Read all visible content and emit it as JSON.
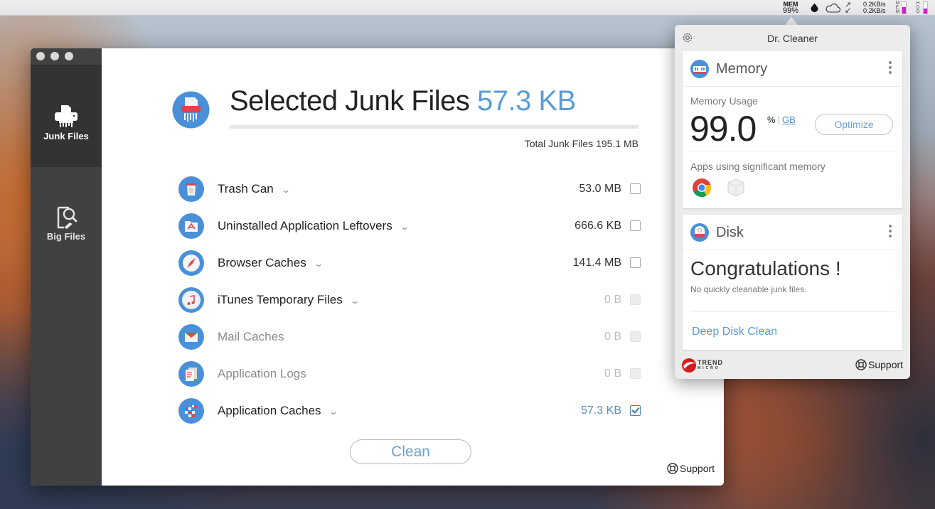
{
  "menubar": {
    "mem_label": "MEM",
    "mem_percent": "99%",
    "net_up": "0.2KB/s",
    "net_down": "0.2KB/s",
    "mem_gauge_label": "MEM",
    "hdd_gauge_label": "HDD",
    "mem_gauge_fill": 0.55,
    "hdd_gauge_fill": 0.45,
    "icons": [
      "drop-icon",
      "cloud-icon",
      "transfer-arrows-icon"
    ]
  },
  "sidebar": {
    "items": [
      {
        "label": "Junk Files",
        "icon": "shredder-icon",
        "active": true
      },
      {
        "label": "Big Files",
        "icon": "file-search-icon",
        "active": false
      }
    ]
  },
  "main": {
    "title_prefix": "Selected Junk Files",
    "selected_size": "57.3 KB",
    "total_label": "Total Junk Files 195.1 MB",
    "rows": [
      {
        "label": "Trash Can",
        "size": "53.0 MB",
        "expandable": true,
        "state": "unchecked",
        "icon": "trash-icon"
      },
      {
        "label": "Uninstalled Application Leftovers",
        "size": "666.6 KB",
        "expandable": true,
        "state": "unchecked",
        "icon": "app-folder-icon"
      },
      {
        "label": "Browser Caches",
        "size": "141.4 MB",
        "expandable": true,
        "state": "unchecked",
        "icon": "compass-icon"
      },
      {
        "label": "iTunes Temporary Files",
        "size": "0 B",
        "expandable": true,
        "state": "disabled",
        "icon": "music-note-icon"
      },
      {
        "label": "Mail Caches",
        "size": "0 B",
        "expandable": false,
        "state": "disabled",
        "icon": "mail-icon"
      },
      {
        "label": "Application Logs",
        "size": "0 B",
        "expandable": false,
        "state": "disabled",
        "icon": "logs-icon"
      },
      {
        "label": "Application Caches",
        "size": "57.3 KB",
        "expandable": true,
        "state": "checked",
        "icon": "blocks-icon"
      }
    ],
    "clean_label": "Clean",
    "support_label": "Support"
  },
  "popover": {
    "title": "Dr. Cleaner",
    "memory": {
      "title": "Memory",
      "usage_label": "Memory Usage",
      "usage_value": "99.0",
      "unit_percent": "%",
      "unit_gb": "GB",
      "optimize_label": "Optimize",
      "apps_label": "Apps using significant memory",
      "apps": [
        "chrome-icon",
        "generic-app-icon"
      ]
    },
    "disk": {
      "title": "Disk",
      "headline": "Congratulations !",
      "subtext": "No quickly cleanable junk files.",
      "deep_clean_label": "Deep Disk Clean"
    },
    "brand_top": "TREND",
    "brand_bottom": "MICRO",
    "support_label": "Support"
  },
  "colors": {
    "accent": "#5b9bd5",
    "sidebar_bg": "#414141",
    "sidebar_active": "#333333",
    "gauge": "#d21bd3"
  }
}
